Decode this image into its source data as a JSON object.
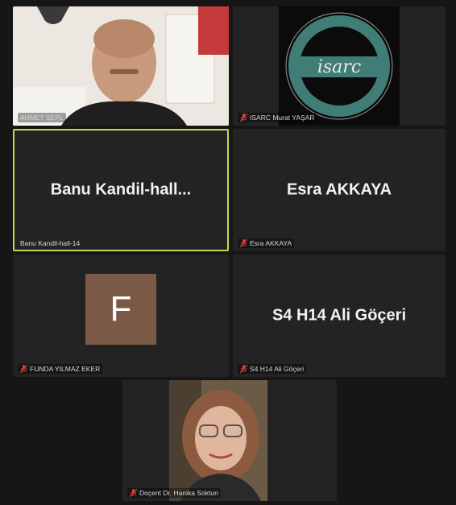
{
  "participants": [
    {
      "name_label": "AHMET ŞEPL",
      "muted": false
    },
    {
      "name_label": "ISARC Murat YAŞAR",
      "muted": true,
      "logo_text": "isarc"
    },
    {
      "display_name": "Banu  Kandil-hall...",
      "name_label": "Banu Kandil-hall-14",
      "muted": false,
      "active": true
    },
    {
      "display_name": "Esra AKKAYA",
      "name_label": "Esra AKKAYA",
      "muted": true
    },
    {
      "avatar_letter": "F",
      "name_label": "FUNDA YILMAZ EKER",
      "muted": true
    },
    {
      "display_name": "S4 H14 Ali Göçeri",
      "name_label": "S4 H14 Ali Göçeri",
      "muted": true
    },
    {
      "name_label": "Doçent Dr. Hanika Soktun",
      "muted": true
    }
  ],
  "colors": {
    "active_border": "#c7d94f",
    "muted_icon": "#e0413a",
    "tile_bg": "#232323",
    "avatar_bg": "#7a5a47"
  }
}
